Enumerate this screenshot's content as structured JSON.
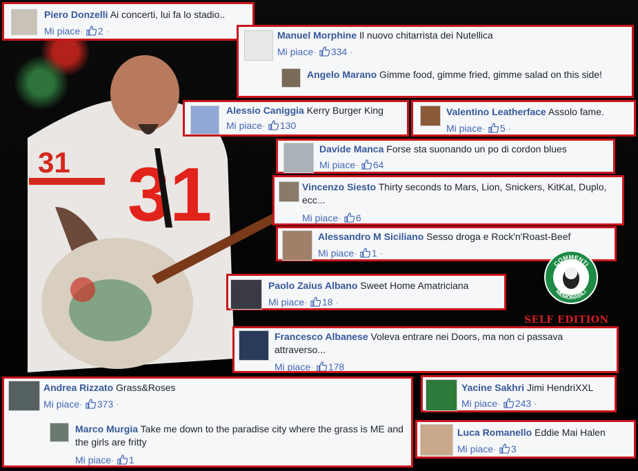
{
  "like_label": "Mi piace",
  "comments": [
    {
      "name": "Piero Donzelli",
      "text": "Ai concerti, lui fa lo stadio..",
      "likes": "2"
    },
    {
      "name": "Manuel Morphine",
      "text": "Il nuovo chitarrista dei Nutellica",
      "likes": "334"
    },
    {
      "name": "Angelo Marano",
      "text": "Gimme food, gimme fried, gimme salad on this side!",
      "likes": ""
    },
    {
      "name": "Alessio Caniggia",
      "text": "Kerry Burger King",
      "likes": "130"
    },
    {
      "name": "Valentino Leatherface",
      "text": "Assolo fame.",
      "likes": "5"
    },
    {
      "name": "Davide Manca",
      "text": "Forse sta suonando un po di cordon blues",
      "likes": "64"
    },
    {
      "name": "Vincenzo Siesto",
      "text": "Thirty seconds to Mars, Lion, Snickers, KitKat, Duplo, ecc...",
      "likes": "6"
    },
    {
      "name": "Alessandro M Siciliano",
      "text": "Sesso droga e Rock'n'Roast-Beef",
      "likes": "1"
    },
    {
      "name": "Paolo Zaius Albano",
      "text": "Sweet Home Amatriciana",
      "likes": "18"
    },
    {
      "name": "Francesco Albanese",
      "text": "Voleva entrare nei Doors, ma non ci passava attraverso...",
      "likes": "178"
    },
    {
      "name": "Andrea Rizzato",
      "text": "Grass&Roses",
      "likes": "373"
    },
    {
      "name": "Marco Murgia",
      "text": "Take me down to the paradise city where the grass is ME and the girls are fritty",
      "likes": "1"
    },
    {
      "name": "Yacine Sakhri",
      "text": "Jimi HendriXXL",
      "likes": "243"
    },
    {
      "name": "Luca Romanello",
      "text": "Eddie Mai Halen",
      "likes": "3"
    }
  ],
  "badge": {
    "top": "COMMENTI",
    "bottom": "MEMORABILI"
  },
  "self_edition": "SELF EDITION",
  "colors": {
    "border": "#c9151c",
    "name": "#365899",
    "like": "#4267b2",
    "card_bg": "#f6f7f9",
    "badge_green": "#1d8a45"
  }
}
